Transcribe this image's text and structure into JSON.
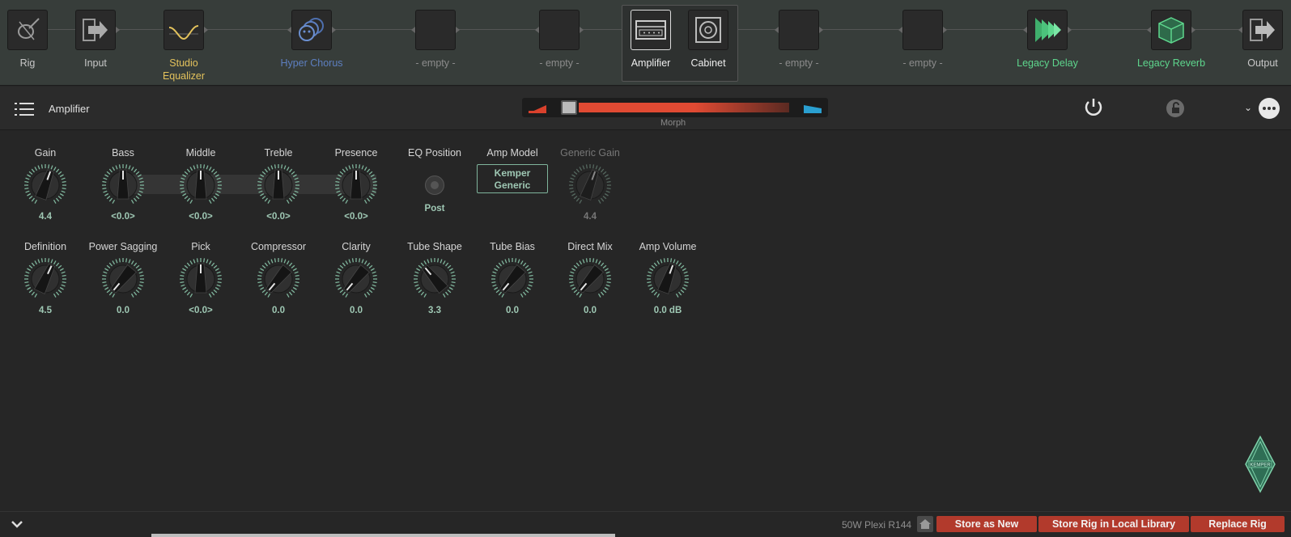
{
  "chain": {
    "slots": [
      {
        "label": "Rig",
        "icon": "rig-guitar-icon"
      },
      {
        "label": "Input",
        "icon": "input-arrow-icon"
      },
      {
        "label": "Studio Equalizer",
        "icon": "eq-curve-icon",
        "color": "#e3c25c"
      },
      {
        "label": "Hyper Chorus",
        "icon": "chorus-faces-icon",
        "color": "#5d7fc0"
      },
      {
        "label": "- empty -"
      },
      {
        "label": "- empty -"
      },
      {
        "label": "Amplifier",
        "icon": "amplifier-icon"
      },
      {
        "label": "Cabinet",
        "icon": "cabinet-speaker-icon"
      },
      {
        "label": "- empty -"
      },
      {
        "label": "- empty -"
      },
      {
        "label": "Legacy Delay",
        "icon": "delay-icon",
        "color": "#5ed68d"
      },
      {
        "label": "Legacy Reverb",
        "icon": "reverb-cube-icon",
        "color": "#5ed68d"
      },
      {
        "label": "Output",
        "icon": "output-arrow-icon"
      }
    ]
  },
  "header": {
    "title": "Amplifier",
    "morph_label": "Morph"
  },
  "params": {
    "row1": [
      {
        "label": "Gain",
        "value": "4.4"
      },
      {
        "label": "Bass",
        "value": "<0.0>"
      },
      {
        "label": "Middle",
        "value": "<0.0>"
      },
      {
        "label": "Treble",
        "value": "<0.0>"
      },
      {
        "label": "Presence",
        "value": "<0.0>"
      },
      {
        "label": "EQ Position",
        "value": "Post"
      },
      {
        "label": "Amp Model",
        "value": "Kemper Generic"
      },
      {
        "label": "Generic Gain",
        "value": "4.4"
      }
    ],
    "row2": [
      {
        "label": "Definition",
        "value": "4.5"
      },
      {
        "label": "Power Sagging",
        "value": "0.0"
      },
      {
        "label": "Pick",
        "value": "<0.0>"
      },
      {
        "label": "Compressor",
        "value": "0.0"
      },
      {
        "label": "Clarity",
        "value": "0.0"
      },
      {
        "label": "Tube Shape",
        "value": "3.3"
      },
      {
        "label": "Tube Bias",
        "value": "0.0"
      },
      {
        "label": "Direct Mix",
        "value": "0.0"
      },
      {
        "label": "Amp Volume",
        "value": "0.0 dB"
      }
    ]
  },
  "footer": {
    "rig_name": "50W Plexi R144",
    "store_new": "Store as New",
    "store_local": "Store Rig in Local Library",
    "replace": "Replace Rig"
  },
  "logo_text": "KEMPER",
  "colors": {
    "accent_red": "#b23a2c",
    "value_green": "#9fc8b4",
    "green_label": "#5ed68d"
  }
}
